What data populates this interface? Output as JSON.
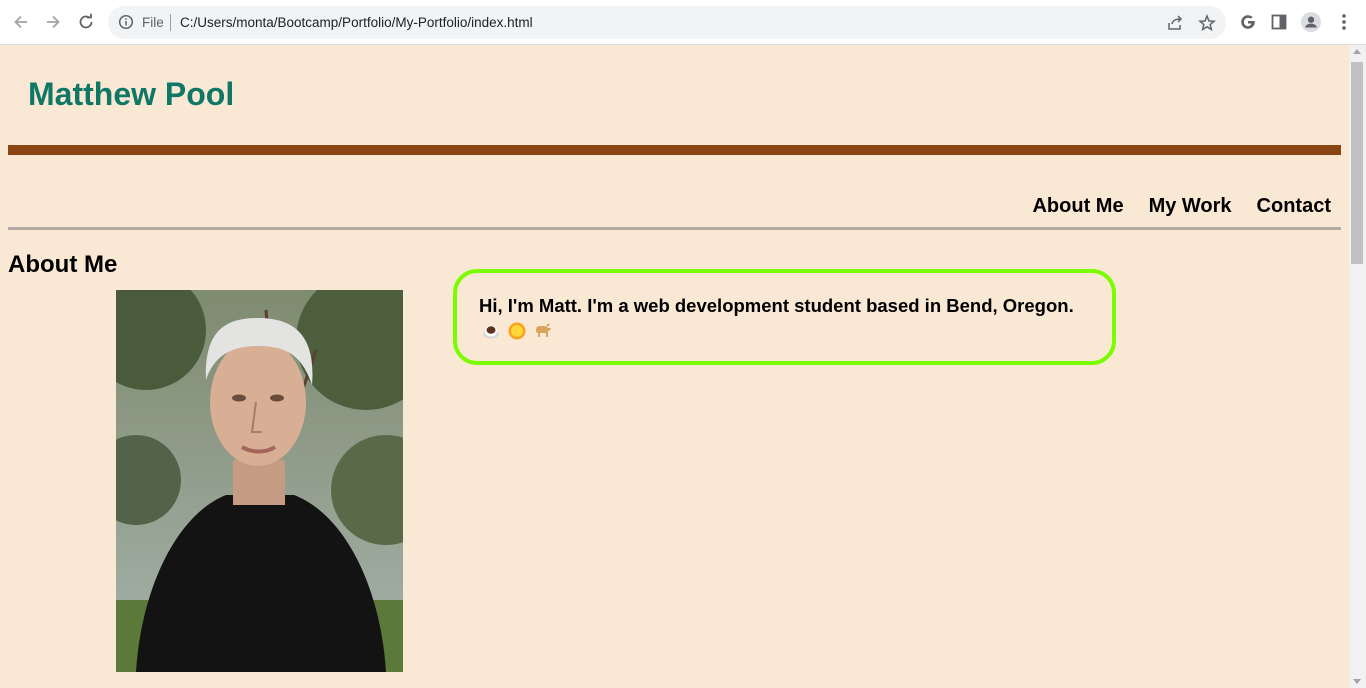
{
  "browser": {
    "omnibox": {
      "scheme_label": "File",
      "url": "C:/Users/monta/Bootcamp/Portfolio/My-Portfolio/index.html"
    },
    "icons": {
      "back": "back-arrow-icon",
      "forward": "forward-arrow-icon",
      "reload": "reload-icon",
      "info": "info-icon",
      "share": "share-icon",
      "bookmark": "star-icon",
      "google": "google-icon",
      "side_panel": "side-panel-icon",
      "profile": "profile-icon",
      "menu": "kebab-menu-icon"
    }
  },
  "site": {
    "title": "Matthew Pool",
    "nav": [
      "About Me",
      "My Work",
      "Contact"
    ],
    "section_title": "About Me",
    "bio": "Hi, I'm Matt. I'm a web development student based in Bend, Oregon.",
    "emojis": [
      "coffee-icon",
      "sun-icon",
      "dog-icon"
    ],
    "colors": {
      "background": "#f9e9d4",
      "title": "#0f7765",
      "bar": "#8b4513",
      "rule": "#b3aaa6",
      "bio_border": "#7cfc00"
    }
  }
}
